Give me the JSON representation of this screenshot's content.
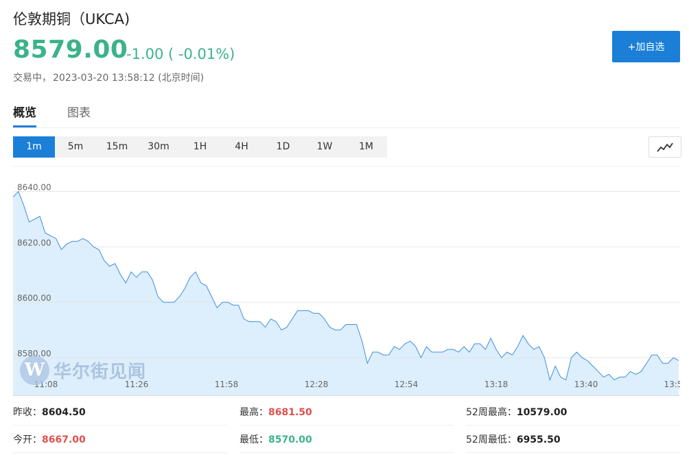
{
  "header": {
    "title": "伦敦期铜（UKCA)",
    "price": "8579.00",
    "change": "-1.00 ( -0.01%)",
    "status_prefix": "交易中，",
    "timestamp": "2023-03-20 13:58:12 (北京时间)",
    "add_button": "+加自选"
  },
  "tabs": [
    {
      "label": "概览",
      "active": true
    },
    {
      "label": "图表",
      "active": false
    }
  ],
  "periods": [
    "1m",
    "5m",
    "15m",
    "30m",
    "1H",
    "4H",
    "1D",
    "1W",
    "1M"
  ],
  "active_period": "1m",
  "chart_type_icon": "line-chart-icon",
  "watermark": {
    "logo": "W",
    "text": "华尔街见闻"
  },
  "colors": {
    "up": "#e0504d",
    "down": "#3bb38a",
    "accent": "#1b7fd8",
    "line": "#3b8fe0",
    "area": "#ddeefc"
  },
  "chart_data": {
    "type": "area",
    "title": "",
    "xlabel": "",
    "ylabel": "",
    "y_ticks": [
      "8640.00",
      "8620.00",
      "8600.00",
      "8580.00"
    ],
    "x_ticks": [
      "11:08",
      "11:26",
      "11:58",
      "12:28",
      "12:54",
      "13:18",
      "13:40",
      "13:5"
    ],
    "ylim": [
      8566.4,
      8649.0
    ],
    "grid": true,
    "values": [
      8638,
      8640,
      8635,
      8629,
      8630,
      8631,
      8625,
      8624,
      8623,
      8619,
      8621,
      8622,
      8622,
      8623,
      8622,
      8620,
      8619,
      8615,
      8613,
      8614,
      8610,
      8607,
      8611,
      8609,
      8611,
      8611,
      8608,
      8602,
      8600,
      8600,
      8600,
      8602,
      8605,
      8609,
      8611,
      8607,
      8606,
      8602,
      8598,
      8600,
      8600,
      8599,
      8599,
      8594,
      8593,
      8593,
      8593,
      8591,
      8594,
      8593,
      8590,
      8591,
      8594,
      8597,
      8597,
      8597,
      8596,
      8596,
      8594,
      8591,
      8590,
      8590,
      8592,
      8592,
      8592,
      8586,
      8578,
      8582,
      8582,
      8581,
      8581,
      8584,
      8583,
      8585,
      8586,
      8584,
      8580,
      8584,
      8582,
      8582,
      8582,
      8583,
      8583,
      8582,
      8584,
      8582,
      8585,
      8585,
      8583,
      8587,
      8583,
      8580,
      8582,
      8581,
      8584,
      8588,
      8585,
      8583,
      8584,
      8580,
      8572,
      8577,
      8573,
      8572,
      8580,
      8582,
      8580,
      8579,
      8577,
      8575,
      8573,
      8574,
      8572,
      8573,
      8573,
      8575,
      8574,
      8575,
      8578,
      8581,
      8581,
      8578,
      8578,
      8580,
      8579
    ]
  },
  "stats": [
    {
      "label": "昨收：",
      "value": "8604.50",
      "color": "default"
    },
    {
      "label": "最高：",
      "value": "8681.50",
      "color": "up"
    },
    {
      "label": "52周最高：",
      "value": "10579.00",
      "color": "default"
    },
    {
      "label": "今开：",
      "value": "8667.00",
      "color": "up"
    },
    {
      "label": "最低：",
      "value": "8570.00",
      "color": "down"
    },
    {
      "label": "52周最低：",
      "value": "6955.50",
      "color": "default"
    }
  ]
}
